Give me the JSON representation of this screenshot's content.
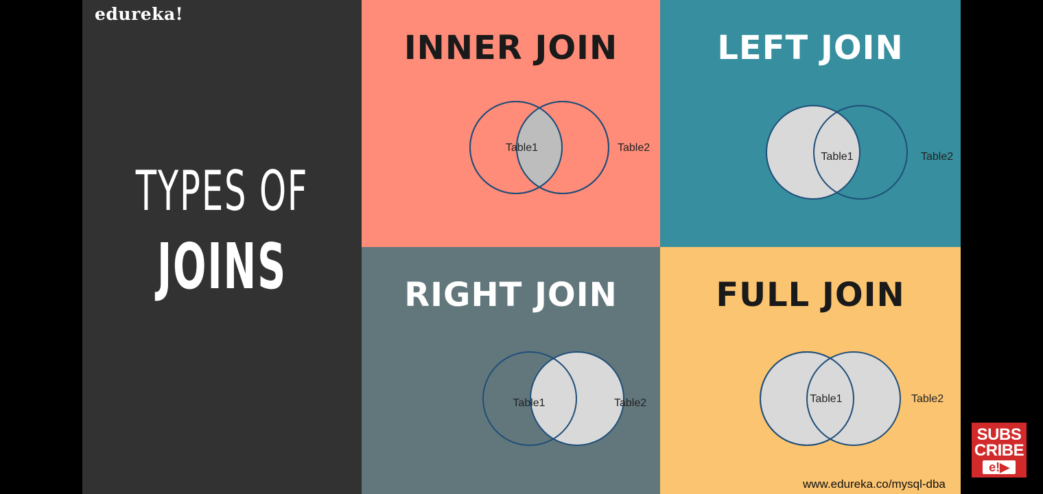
{
  "brand": "edureka!",
  "headline": {
    "line1": "TYPES OF",
    "line2": "JOINS"
  },
  "quadrants": [
    {
      "title": "INNER JOIN",
      "left_label": "Table1",
      "right_label": "Table2",
      "shaded": "intersection",
      "background": "#ff8c78",
      "title_color": "#1a1a1a"
    },
    {
      "title": "LEFT JOIN",
      "left_label": "Table1",
      "right_label": "Table2",
      "shaded": "left",
      "background": "#368e9e",
      "title_color": "#ffffff"
    },
    {
      "title": "RIGHT JOIN",
      "left_label": "Table1",
      "right_label": "Table2",
      "shaded": "right",
      "background": "#62777c",
      "title_color": "#ffffff"
    },
    {
      "title": "FULL JOIN",
      "left_label": "Table1",
      "right_label": "Table2",
      "shaded": "both",
      "background": "#fbc470",
      "title_color": "#1a1a1a"
    }
  ],
  "colors": {
    "venn_fill": "#d9d9d9",
    "inner_fill": "#bdbdbd",
    "venn_stroke": "#1f4e79"
  },
  "footer_url": "www.edureka.co/mysql-dba",
  "subscribe": {
    "line1": "SUBS",
    "line2": "CRIBE",
    "logo": "e!▶"
  }
}
